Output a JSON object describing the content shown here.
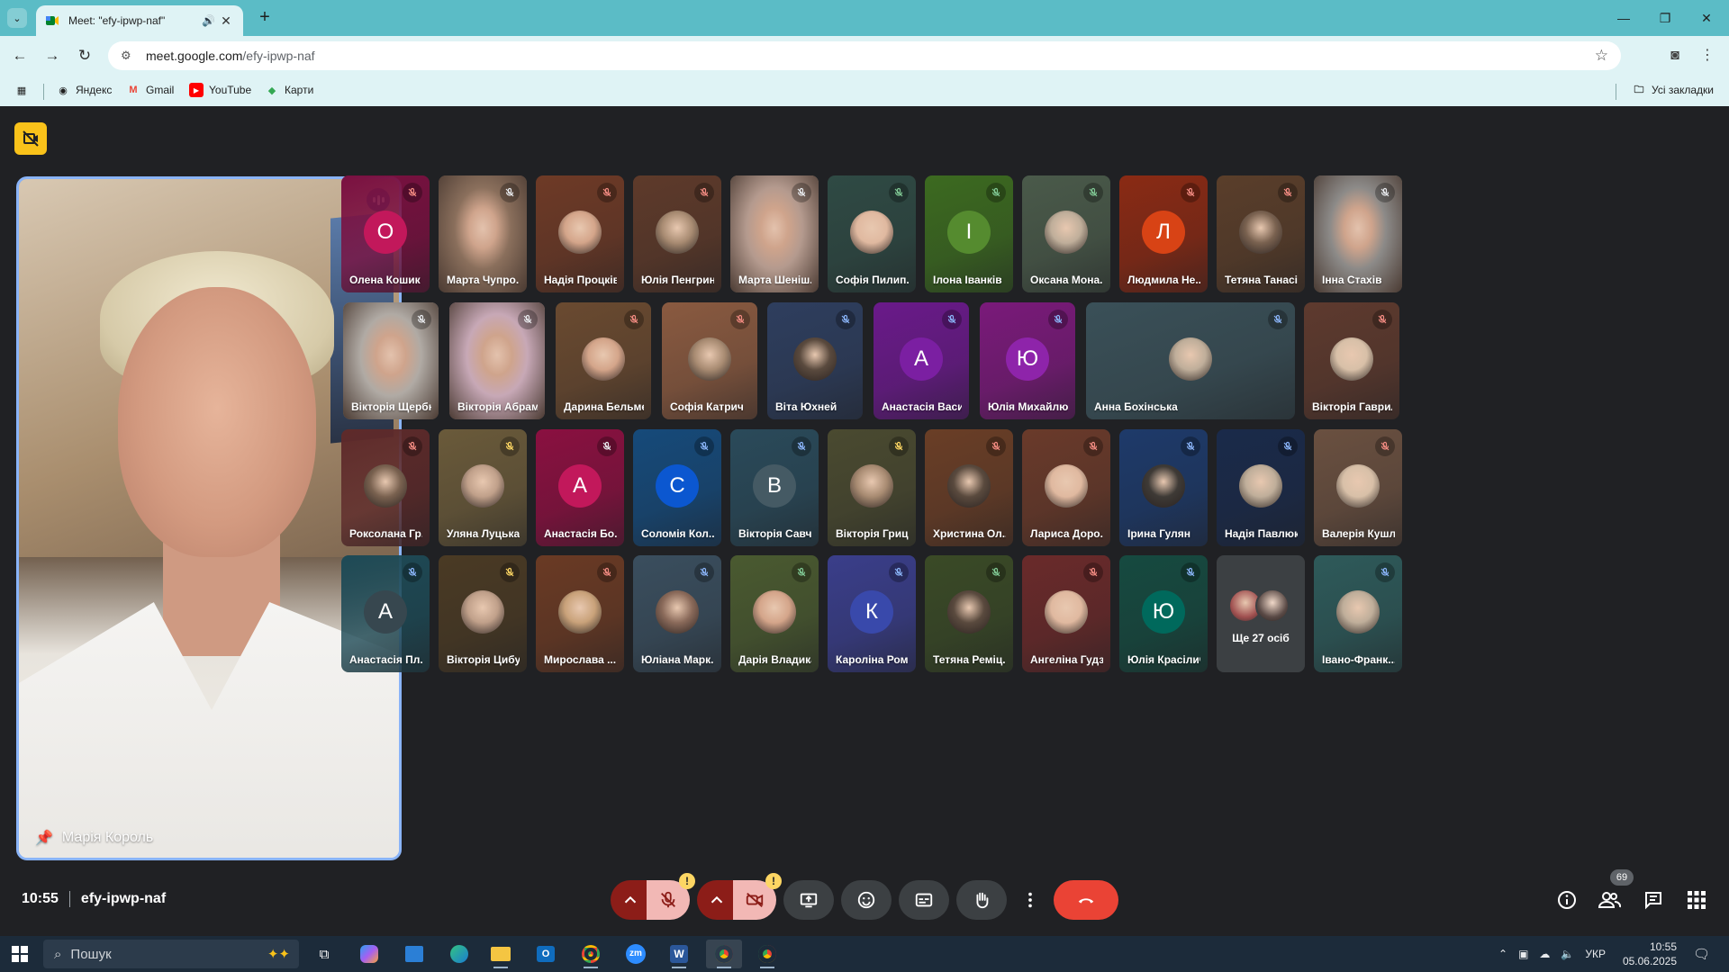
{
  "browser": {
    "tab_title": "Meet: \"efy-ipwp-naf\"",
    "url_host": "meet.google.com",
    "url_path": "/efy-ipwp-naf",
    "bookmarks": [
      "Яндекс",
      "Gmail",
      "YouTube",
      "Карти"
    ],
    "all_bookmarks_label": "Усі закладки"
  },
  "meeting": {
    "time": "10:55",
    "code": "efy-ipwp-naf",
    "presenter_name": "Марія Король",
    "people_count": "69",
    "more_people": "Ще 27 осіб"
  },
  "participants": [
    {
      "name": "Олена Кошик",
      "letter": "О"
    },
    {
      "name": "Марта Чупро..."
    },
    {
      "name": "Надія Процків"
    },
    {
      "name": "Юлія Пенгрин"
    },
    {
      "name": "Марта Шеніш..."
    },
    {
      "name": "Софія Пилип..."
    },
    {
      "name": "Ілона Іванків",
      "letter": "І"
    },
    {
      "name": "Оксана Мона..."
    },
    {
      "name": "Людмила Не...",
      "letter": "Л"
    },
    {
      "name": "Тетяна Танасі..."
    },
    {
      "name": "Інна Стахів"
    },
    {
      "name": "Вікторія Щербюк"
    },
    {
      "name": "Вікторія Абрам"
    },
    {
      "name": "Дарина Бельме..."
    },
    {
      "name": "Софія Катрич"
    },
    {
      "name": "Віта Юхней"
    },
    {
      "name": "Анастасія Васи...",
      "letter": "А"
    },
    {
      "name": "Юлія Михайлюк",
      "letter": "Ю"
    },
    {
      "name": "Анна Бохінська"
    },
    {
      "name": "Вікторія Гаврил..."
    },
    {
      "name": "Роксолана Гр..."
    },
    {
      "name": "Уляна Луцька"
    },
    {
      "name": "Анастасія Бо...",
      "letter": "А"
    },
    {
      "name": "Соломія Кол...",
      "letter": "С"
    },
    {
      "name": "Вікторія Савч...",
      "letter": "В"
    },
    {
      "name": "Вікторія Гриц..."
    },
    {
      "name": "Христина Ол..."
    },
    {
      "name": "Лариса Доро..."
    },
    {
      "name": "Ірина Гулян"
    },
    {
      "name": "Надія Павлюк"
    },
    {
      "name": "Валерія Кушл..."
    },
    {
      "name": "Анастасія Пл...",
      "letter": "А"
    },
    {
      "name": "Вікторія Цибух"
    },
    {
      "name": "Мирослава ..."
    },
    {
      "name": "Юліана Марк..."
    },
    {
      "name": "Дарія Владика"
    },
    {
      "name": "Кароліна Ром...",
      "letter": "К"
    },
    {
      "name": "Тетяна Реміц..."
    },
    {
      "name": "Ангеліна Гудзь"
    },
    {
      "name": "Юлія Красілич",
      "letter": "Ю"
    },
    {
      "name": "Івано-Франк..."
    }
  ],
  "taskbar": {
    "search_placeholder": "Пошук",
    "language": "УКР",
    "clock_time": "10:55",
    "clock_date": "05.06.2025"
  },
  "colors": {
    "tab_strip": "#5bbcc6",
    "toolbar": "#dff3f5",
    "meet_bg": "#202124",
    "end_call": "#ea4335",
    "muted_red": "#8c1d18",
    "active_speaker_border": "#8ab4f8"
  }
}
